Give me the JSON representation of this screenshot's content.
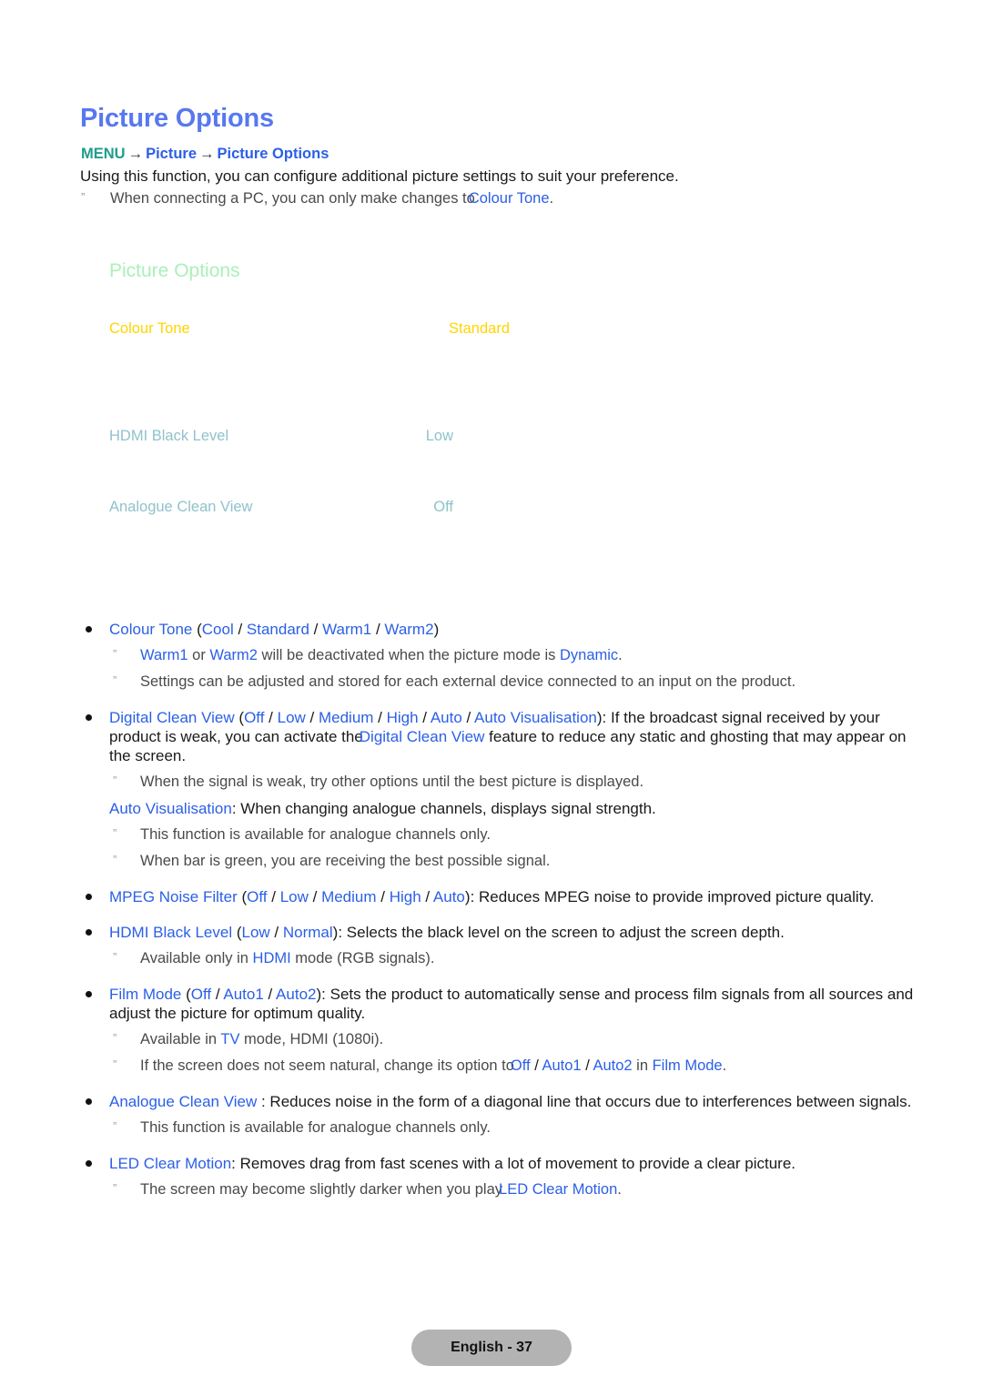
{
  "page_title": "Picture Options",
  "breadcrumb": {
    "menu": "MENU",
    "arrow": "→",
    "level1": "Picture",
    "level2": "Picture Options"
  },
  "intro": "Using this function, you can configure additional picture settings to suit your preference.",
  "intro_note": {
    "marker": "”",
    "text_before": "When connecting a PC, you can only make changes to",
    "highlight": "Colour Tone",
    "text_after": "."
  },
  "osd_panel": {
    "title": "Picture Options",
    "rows": [
      {
        "label": "Colour Tone",
        "value": "Standard",
        "color": "#ffd500"
      },
      {
        "label": "HDMI Black Level",
        "value": "Low",
        "color": "#90c2cc"
      },
      {
        "label": "Analogue Clean View",
        "value": "Off",
        "color": "#90c2cc"
      }
    ]
  },
  "colors": {
    "heading_blue": "#5878ef",
    "link_blue": "#2b5fe6",
    "menu_teal": "#1f9d8c",
    "osd_green": "#aaf0b9",
    "osd_yellow": "#ffd500",
    "osd_teal": "#90c2cc",
    "note_grey": "#4a4a4a",
    "footer_grey": "#b3b3b3"
  },
  "body": {
    "b1_name": "Colour Tone",
    "b1_opt_open": "(",
    "b1_o1": "Cool",
    "b1_s1": " / ",
    "b1_o2": "Standard",
    "b1_s2": " / ",
    "b1_o3": "Warm1",
    "b1_s3": " / ",
    "b1_o4": "Warm2",
    "b1_opt_close": ")",
    "n1_a": "Warm1",
    "n1_b": " or ",
    "n1_c": "Warm2",
    "n1_d": " will be deactivated when the picture mode is ",
    "n1_e": "Dynamic",
    "n1_f": ".",
    "n2": "Settings can be adjusted and stored for each external device connected to an input on the product.",
    "b2_name": "Digital Clean View",
    "b2_opt_open": "(",
    "b2_o1": "Off",
    "b2_o2": "Low",
    "b2_o3": "Medium",
    "b2_o4": "High",
    "b2_o5": "Auto",
    "b2_o6": "Auto Visualisation",
    "b2_opt_close": ")",
    "b2_tail_1": ": If the broadcast signal received by your product is weak, you can activate the",
    "b2_link": "Digital Clean View",
    "b2_tail_2": " feature to reduce any static and ghosting that may appear on the screen.",
    "n3": "When the signal is weak, try other options until the best picture is displayed.",
    "p1_link": "Auto Visualisation",
    "p1_text": ": When changing analogue channels, displays signal strength.",
    "n4": "This function is available for analogue channels only.",
    "n5": "When bar is green, you are receiving the best possible signal.",
    "b3_name": "MPEG Noise Filter",
    "b3_o1": "Off",
    "b3_o2": "Low",
    "b3_o3": "Medium",
    "b3_o4": "High",
    "b3_o5": "Auto",
    "b3_tail": ": Reduces MPEG noise to provide improved picture quality.",
    "b4_name": "HDMI Black Level",
    "b4_o1": "Low",
    "b4_o2": "Normal",
    "b4_tail": ": Selects the black level on the screen to adjust the screen depth.",
    "n6_a": "Available only in ",
    "n6_b": "HDMI",
    "n6_c": " mode (RGB signals).",
    "b5_name": "Film Mode",
    "b5_o1": "Off",
    "b5_o2": "Auto1",
    "b5_o3": "Auto2",
    "b5_tail": ": Sets the product to automatically sense and process film signals from all sources and adjust the picture for optimum quality.",
    "n7_a": "Available in ",
    "n7_b": "TV",
    "n7_c": " mode, HDMI (1080i).",
    "n8_a": "If the screen does not seem natural, change its option to",
    "n8_b": "Off",
    "n8_c": " / ",
    "n8_d": "Auto1",
    "n8_e": " / ",
    "n8_f": "Auto2",
    "n8_g": " in ",
    "n8_h": "Film Mode",
    "n8_i": ".",
    "b6_name": "Analogue Clean View",
    "b6_tail": " : Reduces noise in the form of a diagonal line that occurs due to interferences between signals.",
    "n9": "This function is available for analogue channels only.",
    "b7_name": "LED Clear Motion",
    "b7_tail": ": Removes drag from fast scenes with a lot of movement to provide a clear picture.",
    "n10_a": "The screen may become slightly darker when you play",
    "n10_b": "LED Clear Motion",
    "n10_c": "."
  },
  "footer": {
    "label": "English - 37"
  }
}
